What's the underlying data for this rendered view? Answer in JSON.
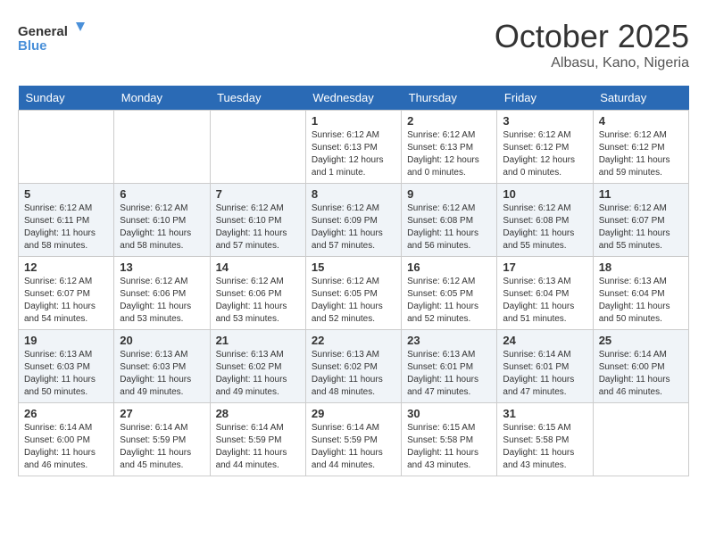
{
  "header": {
    "logo_line1": "General",
    "logo_line2": "Blue",
    "month": "October 2025",
    "location": "Albasu, Kano, Nigeria"
  },
  "days_of_week": [
    "Sunday",
    "Monday",
    "Tuesday",
    "Wednesday",
    "Thursday",
    "Friday",
    "Saturday"
  ],
  "weeks": [
    [
      {
        "day": "",
        "sunrise": "",
        "sunset": "",
        "daylight": ""
      },
      {
        "day": "",
        "sunrise": "",
        "sunset": "",
        "daylight": ""
      },
      {
        "day": "",
        "sunrise": "",
        "sunset": "",
        "daylight": ""
      },
      {
        "day": "1",
        "sunrise": "Sunrise: 6:12 AM",
        "sunset": "Sunset: 6:13 PM",
        "daylight": "Daylight: 12 hours and 1 minute."
      },
      {
        "day": "2",
        "sunrise": "Sunrise: 6:12 AM",
        "sunset": "Sunset: 6:13 PM",
        "daylight": "Daylight: 12 hours and 0 minutes."
      },
      {
        "day": "3",
        "sunrise": "Sunrise: 6:12 AM",
        "sunset": "Sunset: 6:12 PM",
        "daylight": "Daylight: 12 hours and 0 minutes."
      },
      {
        "day": "4",
        "sunrise": "Sunrise: 6:12 AM",
        "sunset": "Sunset: 6:12 PM",
        "daylight": "Daylight: 11 hours and 59 minutes."
      }
    ],
    [
      {
        "day": "5",
        "sunrise": "Sunrise: 6:12 AM",
        "sunset": "Sunset: 6:11 PM",
        "daylight": "Daylight: 11 hours and 58 minutes."
      },
      {
        "day": "6",
        "sunrise": "Sunrise: 6:12 AM",
        "sunset": "Sunset: 6:10 PM",
        "daylight": "Daylight: 11 hours and 58 minutes."
      },
      {
        "day": "7",
        "sunrise": "Sunrise: 6:12 AM",
        "sunset": "Sunset: 6:10 PM",
        "daylight": "Daylight: 11 hours and 57 minutes."
      },
      {
        "day": "8",
        "sunrise": "Sunrise: 6:12 AM",
        "sunset": "Sunset: 6:09 PM",
        "daylight": "Daylight: 11 hours and 57 minutes."
      },
      {
        "day": "9",
        "sunrise": "Sunrise: 6:12 AM",
        "sunset": "Sunset: 6:08 PM",
        "daylight": "Daylight: 11 hours and 56 minutes."
      },
      {
        "day": "10",
        "sunrise": "Sunrise: 6:12 AM",
        "sunset": "Sunset: 6:08 PM",
        "daylight": "Daylight: 11 hours and 55 minutes."
      },
      {
        "day": "11",
        "sunrise": "Sunrise: 6:12 AM",
        "sunset": "Sunset: 6:07 PM",
        "daylight": "Daylight: 11 hours and 55 minutes."
      }
    ],
    [
      {
        "day": "12",
        "sunrise": "Sunrise: 6:12 AM",
        "sunset": "Sunset: 6:07 PM",
        "daylight": "Daylight: 11 hours and 54 minutes."
      },
      {
        "day": "13",
        "sunrise": "Sunrise: 6:12 AM",
        "sunset": "Sunset: 6:06 PM",
        "daylight": "Daylight: 11 hours and 53 minutes."
      },
      {
        "day": "14",
        "sunrise": "Sunrise: 6:12 AM",
        "sunset": "Sunset: 6:06 PM",
        "daylight": "Daylight: 11 hours and 53 minutes."
      },
      {
        "day": "15",
        "sunrise": "Sunrise: 6:12 AM",
        "sunset": "Sunset: 6:05 PM",
        "daylight": "Daylight: 11 hours and 52 minutes."
      },
      {
        "day": "16",
        "sunrise": "Sunrise: 6:12 AM",
        "sunset": "Sunset: 6:05 PM",
        "daylight": "Daylight: 11 hours and 52 minutes."
      },
      {
        "day": "17",
        "sunrise": "Sunrise: 6:13 AM",
        "sunset": "Sunset: 6:04 PM",
        "daylight": "Daylight: 11 hours and 51 minutes."
      },
      {
        "day": "18",
        "sunrise": "Sunrise: 6:13 AM",
        "sunset": "Sunset: 6:04 PM",
        "daylight": "Daylight: 11 hours and 50 minutes."
      }
    ],
    [
      {
        "day": "19",
        "sunrise": "Sunrise: 6:13 AM",
        "sunset": "Sunset: 6:03 PM",
        "daylight": "Daylight: 11 hours and 50 minutes."
      },
      {
        "day": "20",
        "sunrise": "Sunrise: 6:13 AM",
        "sunset": "Sunset: 6:03 PM",
        "daylight": "Daylight: 11 hours and 49 minutes."
      },
      {
        "day": "21",
        "sunrise": "Sunrise: 6:13 AM",
        "sunset": "Sunset: 6:02 PM",
        "daylight": "Daylight: 11 hours and 49 minutes."
      },
      {
        "day": "22",
        "sunrise": "Sunrise: 6:13 AM",
        "sunset": "Sunset: 6:02 PM",
        "daylight": "Daylight: 11 hours and 48 minutes."
      },
      {
        "day": "23",
        "sunrise": "Sunrise: 6:13 AM",
        "sunset": "Sunset: 6:01 PM",
        "daylight": "Daylight: 11 hours and 47 minutes."
      },
      {
        "day": "24",
        "sunrise": "Sunrise: 6:14 AM",
        "sunset": "Sunset: 6:01 PM",
        "daylight": "Daylight: 11 hours and 47 minutes."
      },
      {
        "day": "25",
        "sunrise": "Sunrise: 6:14 AM",
        "sunset": "Sunset: 6:00 PM",
        "daylight": "Daylight: 11 hours and 46 minutes."
      }
    ],
    [
      {
        "day": "26",
        "sunrise": "Sunrise: 6:14 AM",
        "sunset": "Sunset: 6:00 PM",
        "daylight": "Daylight: 11 hours and 46 minutes."
      },
      {
        "day": "27",
        "sunrise": "Sunrise: 6:14 AM",
        "sunset": "Sunset: 5:59 PM",
        "daylight": "Daylight: 11 hours and 45 minutes."
      },
      {
        "day": "28",
        "sunrise": "Sunrise: 6:14 AM",
        "sunset": "Sunset: 5:59 PM",
        "daylight": "Daylight: 11 hours and 44 minutes."
      },
      {
        "day": "29",
        "sunrise": "Sunrise: 6:14 AM",
        "sunset": "Sunset: 5:59 PM",
        "daylight": "Daylight: 11 hours and 44 minutes."
      },
      {
        "day": "30",
        "sunrise": "Sunrise: 6:15 AM",
        "sunset": "Sunset: 5:58 PM",
        "daylight": "Daylight: 11 hours and 43 minutes."
      },
      {
        "day": "31",
        "sunrise": "Sunrise: 6:15 AM",
        "sunset": "Sunset: 5:58 PM",
        "daylight": "Daylight: 11 hours and 43 minutes."
      },
      {
        "day": "",
        "sunrise": "",
        "sunset": "",
        "daylight": ""
      }
    ]
  ]
}
